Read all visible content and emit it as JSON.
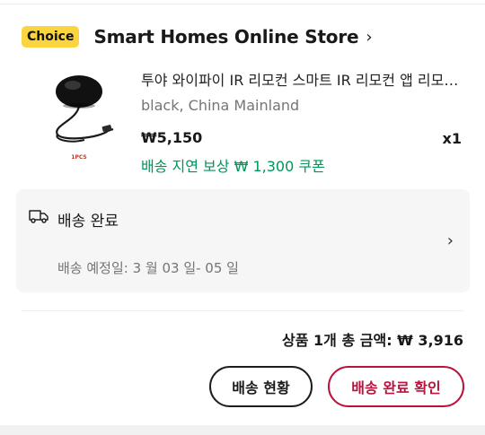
{
  "store": {
    "badge": "Choice",
    "name": "Smart Homes Online Store",
    "chevron": "chevron-right-icon"
  },
  "item": {
    "image_label": "1PCS",
    "title": "투야 와이파이 IR 리모컨 스마트 IR 리모컨 앱 리모컨 스마트 홈",
    "variant": "black, China Mainland",
    "price": "₩5,150",
    "quantity": "x1",
    "coupon": "배송 지연 보상 ₩ 1,300 쿠폰"
  },
  "shipping": {
    "icon": "truck-icon",
    "status": "배송 완료",
    "estimate": "배송 예정일: 3 월 03 일- 05 일"
  },
  "order": {
    "total": "상품 1개 총 금액: ₩ 3,916"
  },
  "actions": {
    "track_label": "배송 현황",
    "confirm_label": "배송 완료 확인"
  },
  "colors": {
    "badge": "#fbd53f",
    "coupon_green": "#00965a",
    "confirm_red": "#b9123d"
  }
}
